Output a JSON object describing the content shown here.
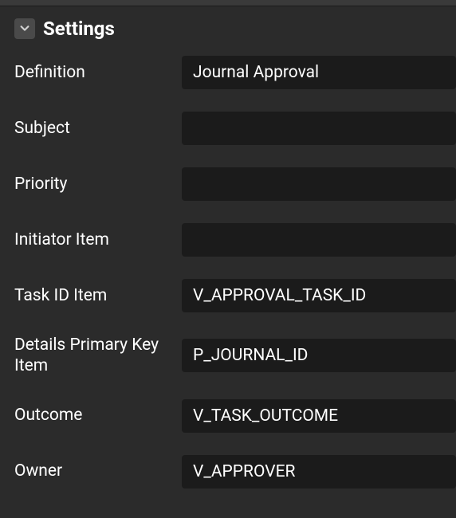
{
  "section": {
    "title": "Settings"
  },
  "fields": {
    "definition": {
      "label": "Definition",
      "value": "Journal Approval"
    },
    "subject": {
      "label": "Subject",
      "value": ""
    },
    "priority": {
      "label": "Priority",
      "value": ""
    },
    "initiator_item": {
      "label": "Initiator Item",
      "value": ""
    },
    "task_id_item": {
      "label": "Task ID Item",
      "value": "V_APPROVAL_TASK_ID"
    },
    "details_primary_key_item": {
      "label": "Details Primary Key Item",
      "value": "P_JOURNAL_ID"
    },
    "outcome": {
      "label": "Outcome",
      "value": "V_TASK_OUTCOME"
    },
    "owner": {
      "label": "Owner",
      "value": "V_APPROVER"
    }
  }
}
